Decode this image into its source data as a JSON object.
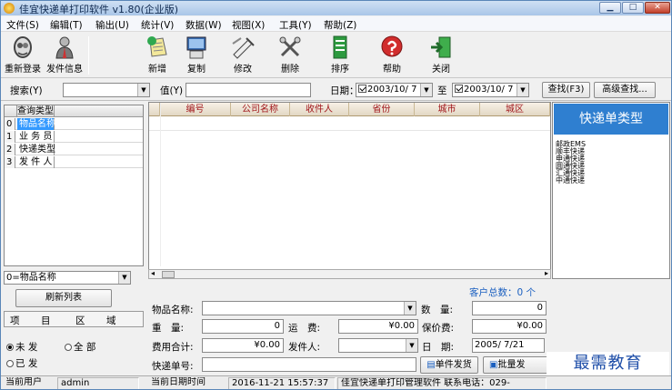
{
  "window": {
    "title": "佳宜快递单打印软件 v1.80(企业版)"
  },
  "menu": [
    "文件(S)",
    "编辑(T)",
    "输出(U)",
    "统计(V)",
    "数据(W)",
    "视图(X)",
    "工具(Y)",
    "帮助(Z)"
  ],
  "toolbar": {
    "relogin": "重新登录",
    "sender_info": "发件信息",
    "add": "新增",
    "copy": "复制",
    "edit": "修改",
    "delete": "删除",
    "sort": "排序",
    "help": "帮助",
    "close": "关闭"
  },
  "search": {
    "search_label": "搜索(Y)",
    "value_label": "值(Y)",
    "date_label": "日期：自",
    "date_from": "2003/10/ 7",
    "to_label": "至",
    "date_to": "2003/10/ 7",
    "find_button": "查找(F3)",
    "advanced_button": "高级查找..."
  },
  "query": {
    "header": "查询类型",
    "rows": [
      {
        "idx": "0",
        "name": "物品名称"
      },
      {
        "idx": "1",
        "name": "业 务 员"
      },
      {
        "idx": "2",
        "name": "快递类型"
      },
      {
        "idx": "3",
        "name": "发 件 人"
      }
    ],
    "select_value": "0=物品名称",
    "refresh_button": "刷新列表",
    "tabs": [
      "项",
      "目",
      "区",
      "域"
    ],
    "radio_unsent": "未 发",
    "radio_all": "全 部",
    "radio_sent": "已 发"
  },
  "grid": {
    "columns": [
      "编号",
      "公司名称",
      "收件人",
      "省份",
      "城市",
      "城区"
    ]
  },
  "express": {
    "title": "快递单类型",
    "items": [
      "邮政EMS",
      "顺丰快递",
      "申通快递",
      "圆通快递",
      "汇通快递",
      "中通快递"
    ]
  },
  "form": {
    "customer_total": "客户总数：0 个",
    "item_name_label": "物品名称:",
    "quantity_label": "数　量:",
    "quantity_value": "0",
    "weight_label": "重　量:",
    "weight_value": "0",
    "freight_label": "运　费:",
    "freight_value": "¥0.00",
    "insured_label": "保价费:",
    "insured_value": "¥0.00",
    "total_label": "费用合计:",
    "total_value": "¥0.00",
    "sender_label": "发件人:",
    "date_label": "日　期:",
    "date_value": "2005/ 7/21",
    "tracking_label": "快递单号:",
    "single_send": "单件发货",
    "batch_send": "批量发"
  },
  "status": {
    "user_label": "当前用户",
    "user": "admin",
    "date_label": "当前日期时间",
    "datetime": "2016-11-21 15:57:37",
    "info": "佳宜快递单打印管理软件 联系电话：029-"
  },
  "watermark": "最需教育",
  "colors": {
    "accent": "#2f7fd0",
    "header_text": "#a0151a",
    "selection": "#3399ff"
  }
}
